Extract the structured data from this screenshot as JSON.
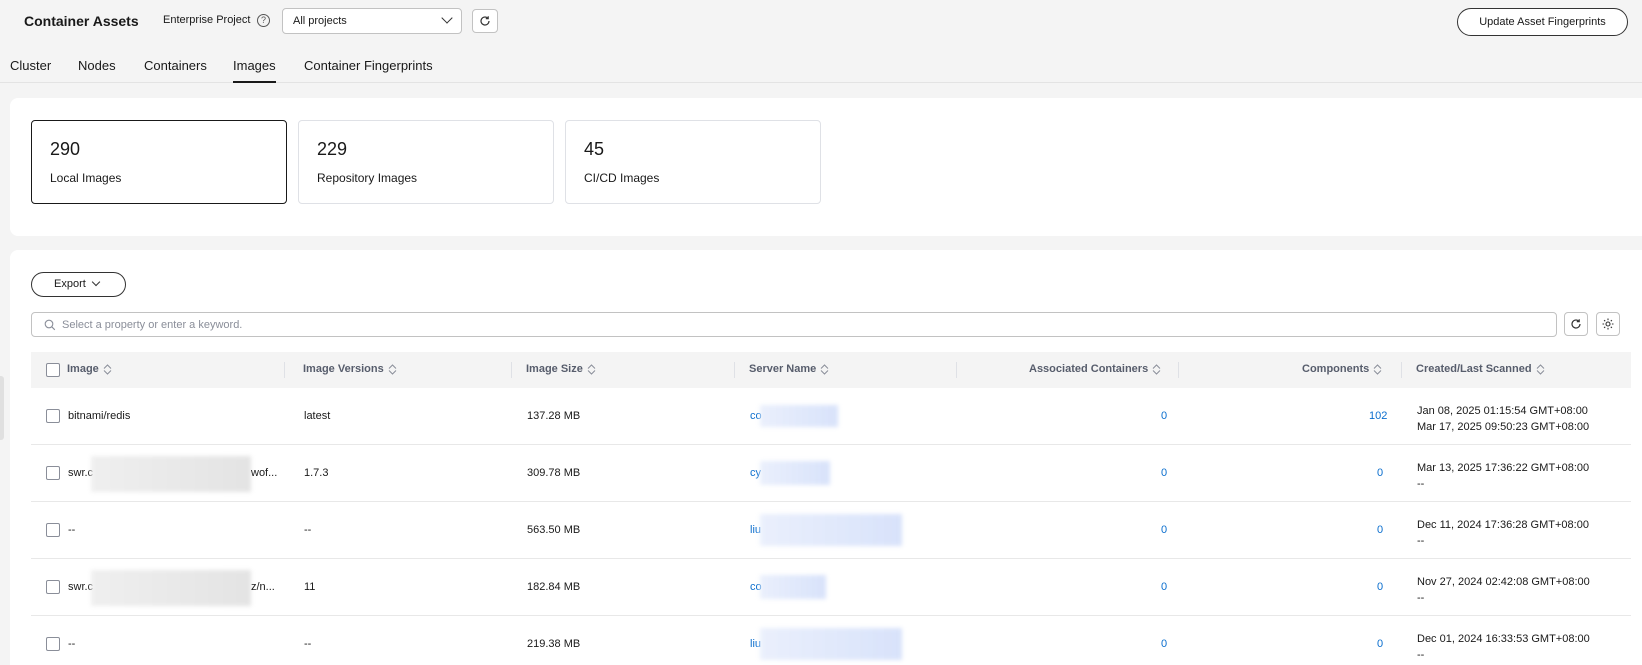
{
  "header": {
    "title": "Container Assets",
    "enterprise_project_label": "Enterprise Project",
    "help_icon": "?",
    "project_select_value": "All projects",
    "update_button": "Update Asset Fingerprints"
  },
  "tabs": [
    {
      "label": "Cluster",
      "active": false
    },
    {
      "label": "Nodes",
      "active": false
    },
    {
      "label": "Containers",
      "active": false
    },
    {
      "label": "Images",
      "active": true
    },
    {
      "label": "Container Fingerprints",
      "active": false
    }
  ],
  "summary_cards": [
    {
      "count": "290",
      "label": "Local Images",
      "selected": true
    },
    {
      "count": "229",
      "label": "Repository Images",
      "selected": false
    },
    {
      "count": "45",
      "label": "CI/CD Images",
      "selected": false
    }
  ],
  "toolbar": {
    "export_label": "Export",
    "search_placeholder": "Select a property or enter a keyword."
  },
  "table": {
    "columns": [
      "Image",
      "Image Versions",
      "Image Size",
      "Server Name",
      "Associated Containers",
      "Components",
      "Created/Last Scanned"
    ],
    "rows": [
      {
        "image": "bitnami/redis",
        "version": "latest",
        "size": "137.28 MB",
        "server": "co",
        "containers": "0",
        "components": "102",
        "created": "Jan 08, 2025 01:15:54 GMT+08:00",
        "scanned": "Mar 17, 2025 09:50:23 GMT+08:00"
      },
      {
        "image": "swr.c",
        "image_suffix": "wof...",
        "version": "1.7.3",
        "size": "309.78 MB",
        "server": "cy",
        "containers": "0",
        "components": "0",
        "created": "Mar 13, 2025 17:36:22 GMT+08:00",
        "scanned": "--"
      },
      {
        "image": "--",
        "version": "--",
        "size": "563.50 MB",
        "server": "liu",
        "containers": "0",
        "components": "0",
        "created": "Dec 11, 2024 17:36:28 GMT+08:00",
        "scanned": "--"
      },
      {
        "image": "swr.c",
        "image_suffix": "z/n...",
        "version": "11",
        "size": "182.84 MB",
        "server": "co",
        "containers": "0",
        "components": "0",
        "created": "Nov 27, 2024 02:42:08 GMT+08:00",
        "scanned": "--"
      },
      {
        "image": "--",
        "version": "--",
        "size": "219.38 MB",
        "server": "liu",
        "containers": "0",
        "components": "0",
        "created": "Dec 01, 2024 16:33:53 GMT+08:00",
        "scanned": "--"
      }
    ]
  },
  "colors": {
    "link": "#0a6ece",
    "border_active": "#191919"
  }
}
